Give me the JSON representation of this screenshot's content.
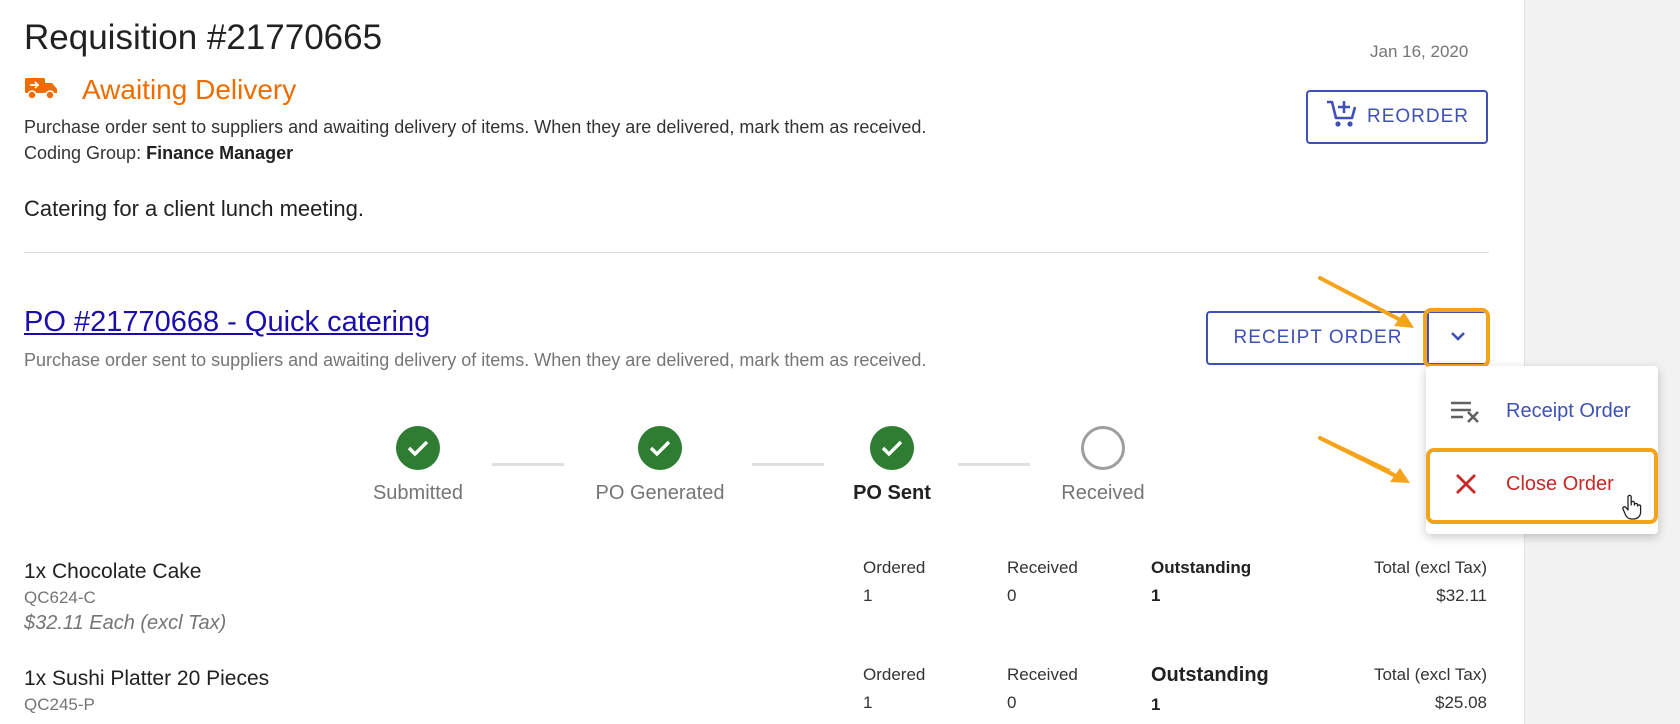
{
  "requisition": {
    "title": "Requisition #21770665",
    "date": "Jan 16, 2020",
    "status": "Awaiting Delivery",
    "status_description": "Purchase order sent to suppliers and awaiting delivery of items. When they are delivered, mark them as received.",
    "coding_group_label": "Coding Group:",
    "coding_group_value": "Finance Manager",
    "note": "Catering for a client lunch meeting.",
    "reorder_label": "REORDER"
  },
  "purchase_order": {
    "title": "PO #21770668 - Quick catering",
    "description": "Purchase order sent to suppliers and awaiting delivery of items. When they are delivered, mark them as received.",
    "receipt_button_label": "RECEIPT ORDER"
  },
  "dropdown_menu": {
    "items": [
      {
        "label": "Receipt Order",
        "icon": "clear-list-icon"
      },
      {
        "label": "Close Order",
        "icon": "close-icon"
      }
    ]
  },
  "progress_steps": [
    {
      "label": "Submitted",
      "state": "done"
    },
    {
      "label": "PO Generated",
      "state": "done"
    },
    {
      "label": "PO Sent",
      "state": "current"
    },
    {
      "label": "Received",
      "state": "pending"
    }
  ],
  "line_items": [
    {
      "name": "1x Chocolate Cake",
      "code": "QC624-C",
      "unit_price": "$32.11 Each (excl Tax)",
      "ordered_label": "Ordered",
      "ordered": "1",
      "received_label": "Received",
      "received": "0",
      "outstanding_label": "Outstanding",
      "outstanding": "1",
      "total_label": "Total (excl Tax)",
      "total": "$32.11"
    },
    {
      "name": "1x Sushi Platter 20 Pieces",
      "code": "QC245-P",
      "ordered_label": "Ordered",
      "ordered": "1",
      "received_label": "Received",
      "received": "0",
      "outstanding_label": "Outstanding",
      "outstanding": "1",
      "total_label": "Total (excl Tax)",
      "total": "$25.08"
    }
  ],
  "colors": {
    "status_orange": "#ef6c00",
    "primary_blue": "#3f51b5",
    "success_green": "#2e7d32",
    "danger_red": "#c62828",
    "highlight_orange": "#f5a31a",
    "link_blue": "#1a0dab"
  }
}
